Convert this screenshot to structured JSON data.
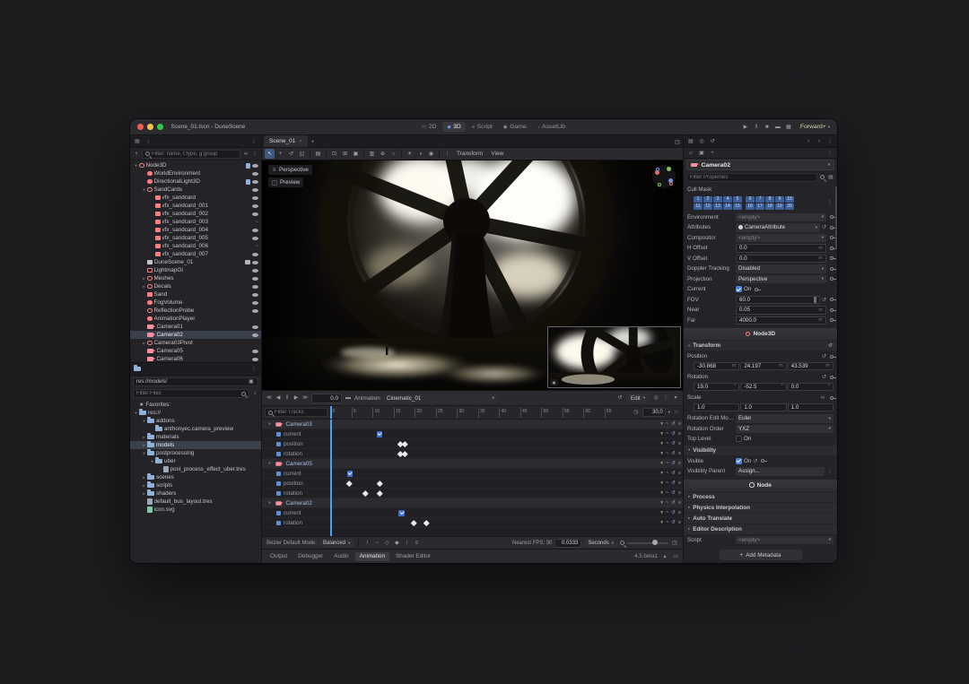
{
  "titlebar": {
    "title": "Scene_01.tscn - DuneScene",
    "workspace_tabs": [
      {
        "label": "2D",
        "active": false
      },
      {
        "label": "3D",
        "active": true
      },
      {
        "label": "Script",
        "active": false
      },
      {
        "label": "Game",
        "active": false
      },
      {
        "label": "AssetLib",
        "active": false
      }
    ],
    "window_icons": [
      "play-icon",
      "pause-icon",
      "stop-icon",
      "movie-maker-icon",
      "grid-icon"
    ],
    "renderer": "Forward+"
  },
  "scene_dock": {
    "dock_icons": [
      "scene-tab-icon",
      "import-tab-icon"
    ],
    "filter_placeholder": "Filter: name, t:type, g:group",
    "nodes": [
      {
        "name": "Node3D",
        "depth": 0,
        "icon": "node3d",
        "arrow": "open",
        "badges": [
          "script",
          "eye"
        ]
      },
      {
        "name": "WorldEnvironment",
        "depth": 1,
        "icon": "environment",
        "badges": [
          "eye"
        ]
      },
      {
        "name": "DirectionalLight3D",
        "depth": 1,
        "icon": "light",
        "badges": [
          "script",
          "eye"
        ]
      },
      {
        "name": "SandCards",
        "depth": 1,
        "icon": "node3d",
        "arrow": "open",
        "badges": [
          "eye"
        ]
      },
      {
        "name": "vfx_sandcard",
        "depth": 2,
        "icon": "mesh",
        "badges": [
          "eye"
        ]
      },
      {
        "name": "vfx_sandcard_001",
        "depth": 2,
        "icon": "mesh",
        "badges": [
          "eye"
        ]
      },
      {
        "name": "vfx_sandcard_002",
        "depth": 2,
        "icon": "mesh",
        "badges": [
          "eye"
        ]
      },
      {
        "name": "vfx_sandcard_003",
        "depth": 2,
        "icon": "mesh",
        "badges": [
          "curve"
        ]
      },
      {
        "name": "vfx_sandcard_004",
        "depth": 2,
        "icon": "mesh",
        "badges": [
          "eye"
        ]
      },
      {
        "name": "vfx_sandcard_005",
        "depth": 2,
        "icon": "mesh",
        "badges": [
          "eye"
        ]
      },
      {
        "name": "vfx_sandcard_006",
        "depth": 2,
        "icon": "mesh",
        "badges": [
          "curve"
        ]
      },
      {
        "name": "vfx_sandcard_007",
        "depth": 2,
        "icon": "mesh",
        "badges": [
          "eye"
        ]
      },
      {
        "name": "DuneScene_01",
        "depth": 1,
        "icon": "scene",
        "badges": [
          "scene",
          "eye"
        ]
      },
      {
        "name": "LightmapGI",
        "depth": 1,
        "icon": "lightmap",
        "badges": [
          "eye"
        ]
      },
      {
        "name": "Meshes",
        "depth": 1,
        "icon": "node3d",
        "arrow": "closed",
        "badges": [
          "eye"
        ]
      },
      {
        "name": "Decals",
        "depth": 1,
        "icon": "node3d",
        "arrow": "closed",
        "badges": [
          "eye"
        ]
      },
      {
        "name": "Sand",
        "depth": 1,
        "icon": "mesh",
        "badges": [
          "eye"
        ]
      },
      {
        "name": "FogVolume",
        "depth": 1,
        "icon": "fog",
        "badges": [
          "eye"
        ]
      },
      {
        "name": "ReflectionProbe",
        "depth": 1,
        "icon": "probe",
        "badges": [
          "eye"
        ]
      },
      {
        "name": "AnimationPlayer",
        "depth": 1,
        "icon": "animation",
        "badges": []
      },
      {
        "name": "Camera01",
        "depth": 1,
        "icon": "camera",
        "badges": [
          "eye"
        ]
      },
      {
        "name": "Camera02",
        "depth": 1,
        "icon": "camera",
        "selected": true,
        "badges": [
          "eye"
        ]
      },
      {
        "name": "Camera03Pivot",
        "depth": 1,
        "icon": "node3d",
        "arrow": "closed",
        "badges": []
      },
      {
        "name": "Camera05",
        "depth": 1,
        "icon": "camera",
        "badges": [
          "eye"
        ]
      },
      {
        "name": "Camera06",
        "depth": 1,
        "icon": "camera",
        "badges": [
          "eye"
        ]
      }
    ]
  },
  "filesystem": {
    "path": "res://models/",
    "filter_placeholder": "Filter Files",
    "items": [
      {
        "name": "Favorites:",
        "depth": 0,
        "icon": "star"
      },
      {
        "name": "res://",
        "depth": 0,
        "icon": "folder",
        "arrow": "open"
      },
      {
        "name": "addons",
        "depth": 1,
        "icon": "folder",
        "arrow": "open"
      },
      {
        "name": "anthonyec.camera_preview",
        "depth": 2,
        "icon": "folder"
      },
      {
        "name": "materials",
        "depth": 1,
        "icon": "folder",
        "arrow": "closed"
      },
      {
        "name": "models",
        "depth": 1,
        "icon": "folder",
        "arrow": "closed",
        "selected": true
      },
      {
        "name": "postprocessing",
        "depth": 1,
        "icon": "folder",
        "arrow": "open"
      },
      {
        "name": "uber",
        "depth": 2,
        "icon": "folder",
        "arrow": "open"
      },
      {
        "name": "post_process_effect_uber.tres",
        "depth": 3,
        "icon": "res"
      },
      {
        "name": "scenes",
        "depth": 1,
        "icon": "folder",
        "arrow": "closed"
      },
      {
        "name": "scripts",
        "depth": 1,
        "icon": "folder",
        "arrow": "closed"
      },
      {
        "name": "shaders",
        "depth": 1,
        "icon": "folder",
        "arrow": "closed"
      },
      {
        "name": "default_bus_layout.tres",
        "depth": 1,
        "icon": "res"
      },
      {
        "name": "icon.svg",
        "depth": 1,
        "icon": "img"
      }
    ]
  },
  "viewport": {
    "tab_title": "Scene_01",
    "toolbar_icons": [
      "select-tool-icon",
      "move-tool-icon",
      "rotate-tool-icon",
      "scale-tool-icon",
      "sep",
      "selection-list-icon",
      "sep",
      "lock-icon",
      "unlock-icon",
      "group-icon",
      "sep",
      "ruler-icon",
      "local-space-icon",
      "snap-icon",
      "sep",
      "sun-icon",
      "environment-icon",
      "camera-preview-icon",
      "sep",
      "dots-menu-icon"
    ],
    "toolbar_menus": [
      "Transform",
      "View"
    ],
    "perspective_label": "Perspective",
    "preview_label": "Preview"
  },
  "animation": {
    "playback_icons": [
      "skip-backward-icon",
      "play-backwards-icon",
      "pause-icon",
      "play-icon",
      "skip-forward-icon"
    ],
    "time": "0.0",
    "panel_label": "Animation",
    "clip_name": "Cinematic_01",
    "edit_label": "Edit",
    "filter_placeholder": "Filter Tracks",
    "fps": "30.0",
    "ruler_ticks": [
      0,
      5,
      10,
      15,
      20,
      25,
      30,
      35,
      40,
      45,
      50,
      55,
      60,
      65
    ],
    "playhead_time": 0,
    "tracks": [
      {
        "type": "group",
        "name": "Camera03",
        "keys": []
      },
      {
        "type": "track",
        "name": "current",
        "kind": "bool",
        "keys": [
          11.5
        ]
      },
      {
        "type": "track",
        "name": "position",
        "kind": "value",
        "keys": [
          16.8,
          17.8
        ]
      },
      {
        "type": "track",
        "name": "rotation",
        "kind": "value",
        "keys": [
          16.8,
          17.8
        ]
      },
      {
        "type": "group",
        "name": "Camera05",
        "keys": []
      },
      {
        "type": "track",
        "name": "current",
        "kind": "bool",
        "keys": [
          4.5
        ]
      },
      {
        "type": "track",
        "name": "position",
        "kind": "value",
        "keys": [
          4.5,
          11.8
        ]
      },
      {
        "type": "track",
        "name": "rotation",
        "kind": "value",
        "keys": [
          8.5,
          11.8
        ]
      },
      {
        "type": "group",
        "name": "Camera02",
        "keys": []
      },
      {
        "type": "track",
        "name": "current",
        "kind": "bool",
        "keys": [
          16.8
        ]
      },
      {
        "type": "track",
        "name": "rotation",
        "kind": "value",
        "keys": [
          19.8,
          22.8
        ]
      }
    ],
    "bezier_label": "Bezier Default Mode:",
    "bezier_mode": "Balanced",
    "nearest_fps_label": "Nearest FPS: 30",
    "step_value": "0.0333",
    "step_unit": "Seconds"
  },
  "status_bar": {
    "tabs": [
      "Output",
      "Debugger",
      "Audio",
      "Animation",
      "Shader Editor"
    ],
    "active_tab": "Animation",
    "version": "4.5.beta1"
  },
  "inspector": {
    "node_name": "Camera02",
    "filter_placeholder": "Filter Properties",
    "cull_mask": {
      "label": "Cull Mask",
      "values": [
        1,
        2,
        3,
        4,
        5,
        6,
        7,
        8,
        9,
        10,
        11,
        12,
        13,
        14,
        15,
        16,
        17,
        18,
        19,
        20
      ]
    },
    "sections": [
      {
        "type": "properties",
        "rows": [
          {
            "label": "Environment",
            "control": "resource",
            "value": "<empty>",
            "keyable": true
          },
          {
            "label": "Attributes",
            "control": "resource",
            "value": "CameraAttribute",
            "icon": "camera-attributes-icon",
            "revert": true,
            "keyable": true
          },
          {
            "label": "Compositor",
            "control": "resource",
            "value": "<empty>",
            "keyable": true
          },
          {
            "label": "H Offset",
            "control": "number",
            "value": "0.0",
            "unit": "m",
            "keyable": true
          },
          {
            "label": "V Offset",
            "control": "number",
            "value": "0.0",
            "unit": "m",
            "keyable": true
          },
          {
            "label": "Doppler Tracking",
            "control": "select",
            "value": "Disabled",
            "keyable": true
          },
          {
            "label": "Projection",
            "control": "select",
            "value": "Perspective",
            "keyable": true
          },
          {
            "label": "Current",
            "control": "check",
            "checked": true,
            "value": "On",
            "keyable": true
          },
          {
            "label": "FOV",
            "control": "slider",
            "value": "60.0",
            "revert": true,
            "keyable": true
          },
          {
            "label": "Near",
            "control": "number",
            "value": "0.05",
            "unit": "m",
            "keyable": true
          },
          {
            "label": "Far",
            "control": "number",
            "value": "4000.0",
            "unit": "m",
            "keyable": true
          }
        ]
      },
      {
        "type": "category",
        "label": "Node3D",
        "icon": "node3d"
      },
      {
        "type": "subheader",
        "label": "Transform",
        "revert": true
      },
      {
        "type": "vec3",
        "label": "Position",
        "values": [
          "-30.868",
          "24.197",
          "43.539"
        ],
        "unit": "m",
        "revert": true,
        "keyable": true
      },
      {
        "type": "vec3",
        "label": "Rotation",
        "values": [
          "19.0",
          "-52.5",
          "0.0"
        ],
        "unit": "°",
        "revert": true,
        "keyable": true
      },
      {
        "type": "vec3",
        "label": "Scale",
        "values": [
          "1.0",
          "1.0",
          "1.0"
        ],
        "unit": "",
        "link": true,
        "keyable": true
      },
      {
        "type": "properties",
        "rows": [
          {
            "label": "Rotation Edit Mode",
            "control": "select",
            "value": "Euler"
          },
          {
            "label": "Rotation Order",
            "control": "select",
            "value": "YXZ"
          },
          {
            "label": "Top Level",
            "control": "check",
            "checked": false,
            "value": "On"
          }
        ]
      },
      {
        "type": "subheader",
        "label": "Visibility"
      },
      {
        "type": "properties",
        "rows": [
          {
            "label": "Visible",
            "control": "check",
            "checked": true,
            "value": "On",
            "revert": true,
            "keyable": true
          },
          {
            "label": "Visibility Parent",
            "control": "button",
            "value": "Assign...",
            "menu": true
          }
        ]
      },
      {
        "type": "category",
        "label": "Node",
        "icon": "node"
      },
      {
        "type": "subheader",
        "label": "Process",
        "collapsed": true
      },
      {
        "type": "subheader",
        "label": "Physics Interpolation",
        "collapsed": true
      },
      {
        "type": "subheader",
        "label": "Auto Translate",
        "collapsed": true
      },
      {
        "type": "subheader",
        "label": "Editor Description",
        "collapsed": true
      },
      {
        "type": "properties",
        "rows": [
          {
            "label": "Script",
            "control": "resource",
            "value": "<empty>"
          }
        ]
      }
    ],
    "add_metadata_label": "Add Metadata"
  },
  "colors": {
    "accent": "#4f9cf5",
    "node_3d": "#fc7f7f",
    "selection": "#3a414c",
    "cull_enabled": "#3c5f9a",
    "renderer_label": "#ddd9a2"
  }
}
